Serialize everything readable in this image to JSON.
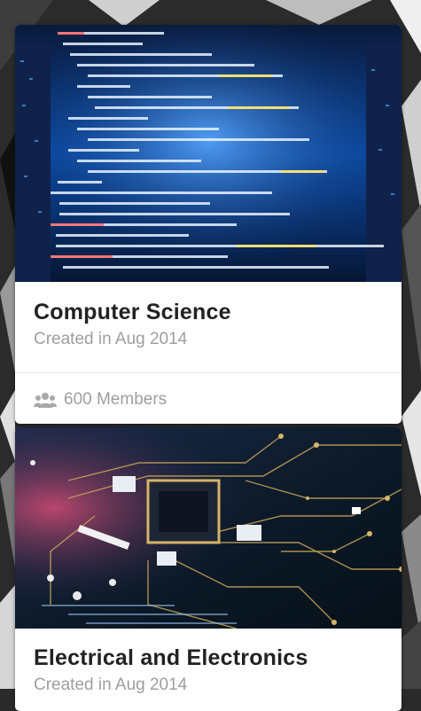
{
  "cards": [
    {
      "title": "Computer Science",
      "created": "Created in Aug 2014",
      "members": "600 Members",
      "image_subject": "code-on-screen-image"
    },
    {
      "title": "Electrical and Electronics",
      "created": "Created in Aug 2014",
      "image_subject": "circuit-board-image"
    }
  ],
  "colors": {
    "title": "#222222",
    "meta": "#9e9e9e",
    "code_blue": "#1565c0",
    "board_dark": "#0d1b2a"
  }
}
